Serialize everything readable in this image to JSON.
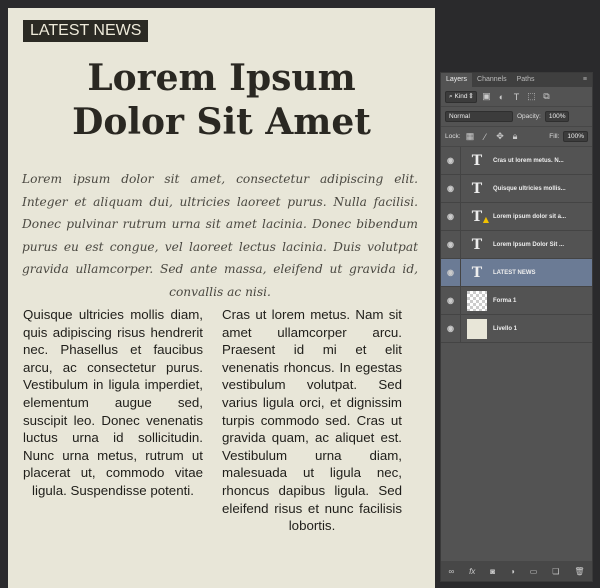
{
  "document": {
    "badge": "LATEST NEWS",
    "headline_1": "Lorem Ipsum",
    "headline_2": "Dolor Sit Amet",
    "lead": "Lorem ipsum dolor sit amet, consectetur adipiscing elit. Integer et aliquam dui, ultricies laoreet purus. Nulla facilisi. Donec pulvinar rutrum urna sit amet lacinia. Donec bibendum purus eu est congue, vel laoreet lectus lacinia. Duis volutpat gravida ullamcorper. Sed ante massa, eleifend ut gravida id, convallis ac nisi.",
    "col1": "Quisque ultricies mollis diam, quis adipiscing risus hendrerit nec. Phasellus et faucibus arcu, ac consectetur purus. Vestibulum in ligula imperdiet, elementum augue sed, suscipit leo. Donec venenatis luctus urna id sollicitudin. Nunc urna metus, rutrum ut placerat ut, commodo vitae ligula. Suspendisse potenti.",
    "col2": "Cras ut lorem metus. Nam sit amet ullamcorper arcu. Praesent id mi et elit venenatis rhoncus. In egestas vestibulum volutpat. Sed varius ligula orci, et dignissim turpis commodo sed. Cras ut gravida quam, ac aliquet est. Vestibulum urna diam, malesuada ut ligula nec, rhoncus dapibus ligula. Sed eleifend risus et nunc facilisis lobortis."
  },
  "panel": {
    "tabs": [
      "Layers",
      "Channels",
      "Paths"
    ],
    "filter": "Kind",
    "blend": "Normal",
    "opacity_label": "Opacity:",
    "opacity": "100%",
    "lock_label": "Lock:",
    "fill_label": "Fill:",
    "fill": "100%",
    "layers": [
      {
        "name": "Cras ut lorem metus. N...",
        "type": "text-warped"
      },
      {
        "name": "Quisque ultricies mollis...",
        "type": "text-warped"
      },
      {
        "name": "Lorem ipsum dolor sit a...",
        "type": "text-warning"
      },
      {
        "name": "Lorem Ipsum Dolor Sit ...",
        "type": "text"
      },
      {
        "name": "LATEST NEWS",
        "type": "text-warped",
        "selected": true
      },
      {
        "name": "Forma 1",
        "type": "shape"
      },
      {
        "name": "Livello 1",
        "type": "fill"
      }
    ]
  }
}
